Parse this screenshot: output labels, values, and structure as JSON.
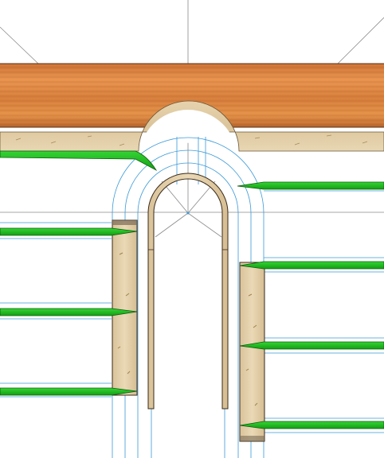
{
  "drawing": {
    "colors": {
      "background": "#ffffff",
      "construction_line": "#8a8a8a",
      "guide_line": "#3a9ad9",
      "shelf_green": "#1fb31f",
      "shelf_edge": "#0c5a0c",
      "wood_top_light": "#e08a47",
      "wood_top_dark": "#b9652c",
      "wood_pale": "#e2cfa8",
      "wood_pale_grain": "#b89c6e",
      "outline": "#3a2a1a"
    },
    "parts": {
      "top_plank": "wood-top-plank",
      "header_beam": "header-beam",
      "arch_ring": "arch-ring",
      "left_post": "left-post",
      "right_post": "right-post",
      "left_shelves": 4,
      "right_shelves": 4
    }
  }
}
